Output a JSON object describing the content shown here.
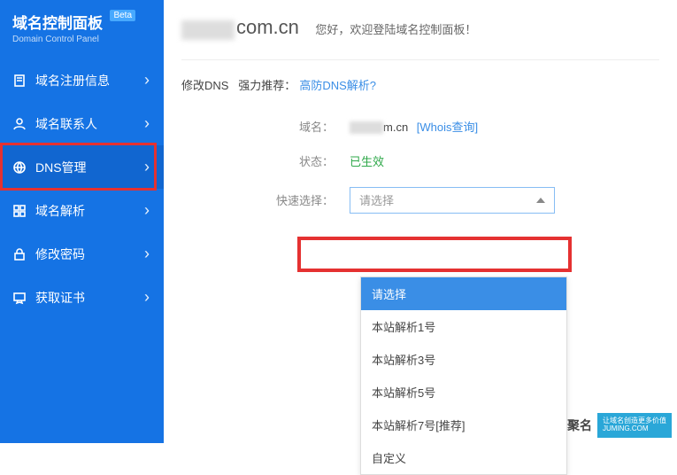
{
  "brand": {
    "title": "域名控制面板",
    "badge": "Beta",
    "subtitle": "Domain Control Panel"
  },
  "nav": [
    {
      "label": "域名注册信息",
      "icon": "doc"
    },
    {
      "label": "域名联系人",
      "icon": "user"
    },
    {
      "label": "DNS管理",
      "icon": "globe"
    },
    {
      "label": "域名解析",
      "icon": "grid"
    },
    {
      "label": "修改密码",
      "icon": "lock"
    },
    {
      "label": "获取证书",
      "icon": "cert"
    }
  ],
  "header": {
    "domain_suffix": "com.cn",
    "welcome": "您好，欢迎登陆域名控制面板！"
  },
  "section": {
    "title": "修改DNS",
    "recommend_label": "强力推荐：",
    "recommend_link": "高防DNS解析?"
  },
  "fields": {
    "domain": {
      "label": "域名：",
      "value_suffix": "m.cn",
      "whois": "[Whois查询]"
    },
    "status": {
      "label": "状态：",
      "value": "已生效"
    },
    "quick": {
      "label": "快速选择：",
      "placeholder": "请选择"
    }
  },
  "dropdown": [
    "请选择",
    "本站解析1号",
    "本站解析3号",
    "本站解析5号",
    "本站解析7号[推荐]",
    "自定义"
  ],
  "watermark": {
    "name": "聚名",
    "tagline1": "让域名创造更多价值",
    "tagline2": "JUMING.COM"
  }
}
